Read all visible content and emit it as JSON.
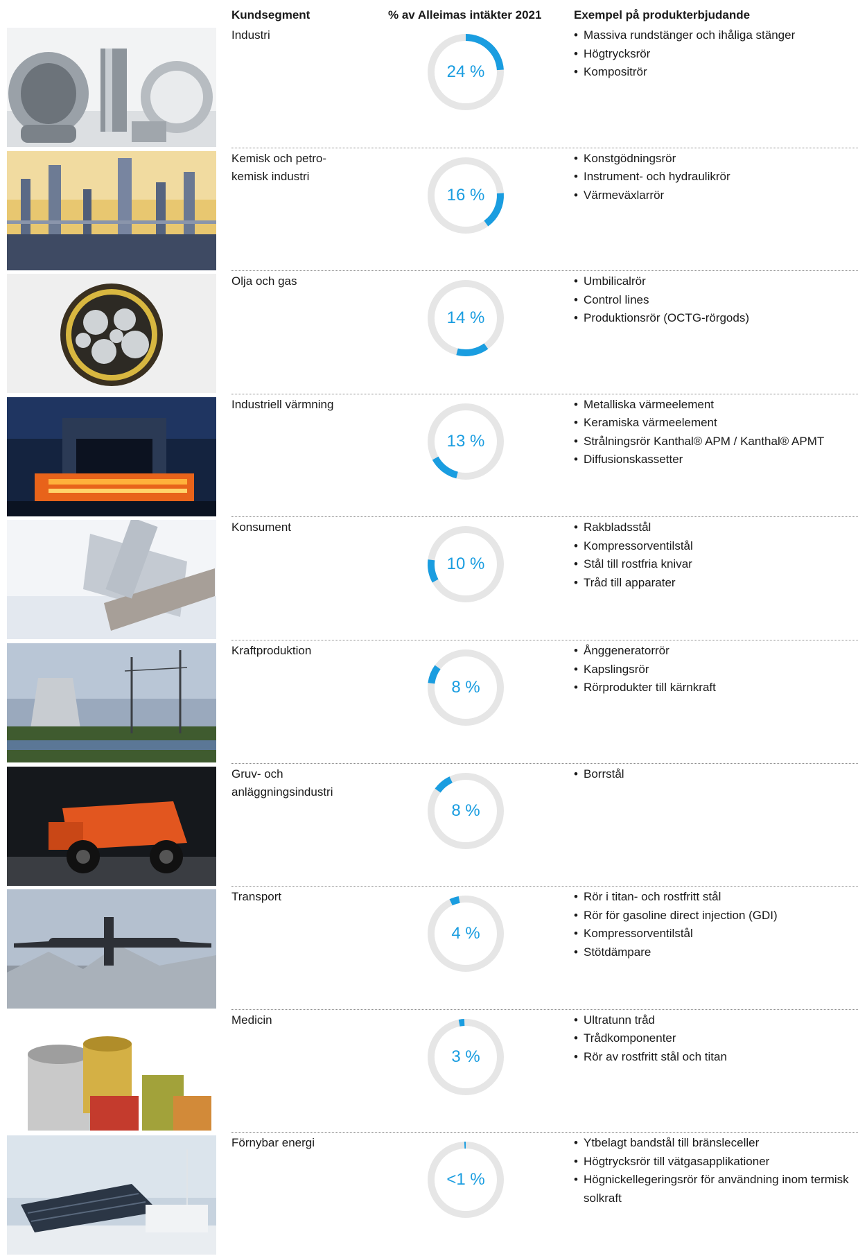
{
  "headers": {
    "segment": "Kundsegment",
    "share": "% av Alleimas intäkter 2021",
    "products": "Exempel på produkterbjudande"
  },
  "colors": {
    "accent": "#1a9de0",
    "ring": "#e6e6e6"
  },
  "rows": [
    {
      "segment": "Industri",
      "share_label": "24 %",
      "share": 24,
      "arc_start": 0,
      "arc_len": 24,
      "photo": "metal-tubes-photo",
      "products": [
        "Massiva rundstänger och ihåliga stänger",
        "Högtrycksrör",
        "Kompositrör"
      ]
    },
    {
      "segment": "Kemisk och petro-\nkemisk industri",
      "share_label": "16 %",
      "share": 16,
      "arc_start": 24,
      "arc_len": 16,
      "photo": "refinery-photo",
      "products": [
        "Konstgödningsrör",
        "Instrument- och hydraulikrör",
        "Värmeväxlarrör"
      ]
    },
    {
      "segment": "Olja och gas",
      "share_label": "14 %",
      "share": 14,
      "arc_start": 40,
      "arc_len": 14,
      "photo": "umbilical-cable-photo",
      "products": [
        "Umbilicalrör",
        "Control lines",
        "Produktionsrör (OCTG-rörgods)"
      ]
    },
    {
      "segment": "Industriell värmning",
      "share_label": "13 %",
      "share": 13,
      "arc_start": 54,
      "arc_len": 13,
      "photo": "furnace-photo",
      "products": [
        "Metalliska värmeelement",
        "Keramiska värmeelement",
        "Strålningsrör Kanthal® APM / Kanthal® APMT",
        "Diffusionskassetter"
      ]
    },
    {
      "segment": "Konsument",
      "share_label": "10 %",
      "share": 10,
      "arc_start": 67,
      "arc_len": 10,
      "photo": "razor-photo",
      "products": [
        "Rakbladsstål",
        "Kompressorventilstål",
        "Stål till rostfria knivar",
        "Tråd till apparater"
      ]
    },
    {
      "segment": "Kraftproduktion",
      "share_label": "8 %",
      "share": 8,
      "arc_start": 77,
      "arc_len": 8,
      "photo": "power-plant-photo",
      "products": [
        "Ånggeneratorrör",
        "Kapslingsrör",
        "Rörprodukter till kärnkraft"
      ]
    },
    {
      "segment": "Gruv- och\nanläggningsindustri",
      "share_label": "8 %",
      "share": 8,
      "arc_start": 85,
      "arc_len": 8,
      "photo": "mining-truck-photo",
      "products": [
        "Borrstål"
      ]
    },
    {
      "segment": "Transport",
      "share_label": "4 %",
      "share": 4,
      "arc_start": 93,
      "arc_len": 4,
      "photo": "airplane-photo",
      "products": [
        "Rör i titan- och rostfritt stål",
        "Rör för gasoline direct injection (GDI)",
        "Kompressorventilstål",
        "Stötdämpare"
      ]
    },
    {
      "segment": "Medicin",
      "share_label": "3 %",
      "share": 3,
      "arc_start": 97,
      "arc_len": 2.4,
      "photo": "wire-spools-photo",
      "products": [
        "Ultratunn tråd",
        "Trådkomponenter",
        "Rör av rostfritt stål och titan"
      ]
    },
    {
      "segment": "Förnybar energi",
      "share_label": "<1 %",
      "share": 1,
      "arc_start": 99.4,
      "arc_len": 0.6,
      "photo": "solar-panels-photo",
      "products": [
        "Ytbelagt bandstål till bränsleceller",
        "Högtrycksrör till vätgasapplikationer",
        "Högnickellegeringsrör för användning inom termisk solkraft"
      ]
    }
  ]
}
